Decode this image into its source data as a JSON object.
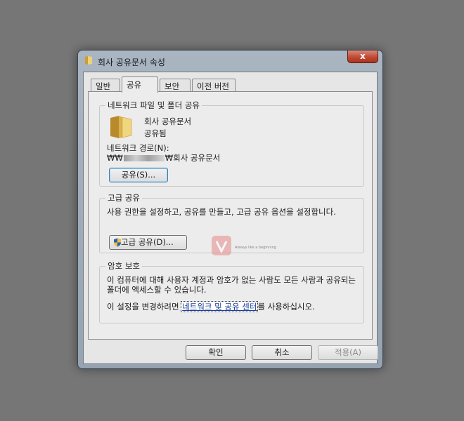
{
  "window": {
    "title": "회사 공유문서 속성",
    "close_label": "x"
  },
  "tabs": [
    {
      "label": "일반",
      "active": false
    },
    {
      "label": "공유",
      "active": true
    },
    {
      "label": "보안",
      "active": false
    },
    {
      "label": "이전 버전",
      "active": false
    }
  ],
  "network_sharing": {
    "group_title": "네트워크 파일 및 폴더 공유",
    "folder_name": "회사 공유문서",
    "status": "공유됨",
    "path_label": "네트워크 경로(N):",
    "path_prefix": "₩₩",
    "path_suffix": "₩회사 공유문서",
    "share_button": "공유(S)..."
  },
  "advanced_sharing": {
    "group_title": "고급 공유",
    "description": "사용 권한을 설정하고, 공유를 만들고, 고급 공유 옵션을 설정합니다.",
    "button": "고급 공유(D)..."
  },
  "password_protection": {
    "group_title": "암호 보호",
    "description": "이 컴퓨터에 대해 사용자 계정과 암호가 없는 사람도 모든 사람과 공유되는 폴더에 액세스할 수 있습니다.",
    "change_prefix": "이 설정을 변경하려면 ",
    "link": "네트워크 및 공유 센터",
    "change_suffix": "를 사용하십시오."
  },
  "footer": {
    "ok": "확인",
    "cancel": "취소",
    "apply": "적용(A)"
  },
  "watermark": {
    "text": "Always like a beginning"
  },
  "colors": {
    "link": "#1a3e9e",
    "close_button": "#c04a33",
    "folder": "#e7c15b"
  }
}
